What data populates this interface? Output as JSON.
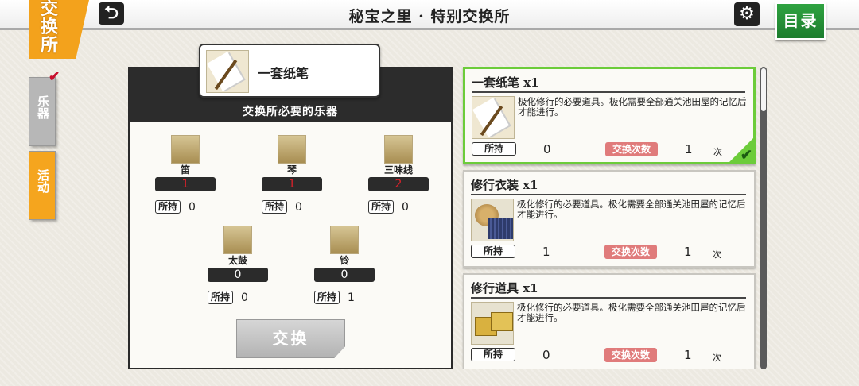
{
  "header": {
    "shop_badge": "交换所",
    "title": "秘宝之里 · 特别交换所",
    "back_icon": "back-arrow-icon",
    "settings_icon": "gear-icon",
    "menu_label": "目录"
  },
  "side_tabs": [
    {
      "label": "乐器",
      "selected": true
    },
    {
      "label": "活动",
      "selected": false
    }
  ],
  "exchange_panel": {
    "selected_item": {
      "name": "一套纸笔"
    },
    "required_heading": "交换所必要的乐器",
    "own_label": "所持",
    "instruments": [
      {
        "name": "笛",
        "required": "1",
        "owned": "0",
        "required_color": "#d8222a"
      },
      {
        "name": "琴",
        "required": "1",
        "owned": "0",
        "required_color": "#d8222a"
      },
      {
        "name": "三味线",
        "required": "2",
        "owned": "0",
        "required_color": "#d8222a"
      },
      {
        "name": "太鼓",
        "required": "0",
        "owned": "0",
        "required_color": "#ffffff"
      },
      {
        "name": "铃",
        "required": "0",
        "owned": "1",
        "required_color": "#ffffff"
      }
    ],
    "exchange_button": "交换"
  },
  "item_list": {
    "own_label": "所持",
    "limit_label": "交换次数",
    "times_unit": "次",
    "items": [
      {
        "name": "一套纸笔 x1",
        "description": "极化修行的必要道具。极化需要全部通关池田屋的记忆后才能进行。",
        "owned": "0",
        "limit": "1",
        "selected": true
      },
      {
        "name": "修行衣装 x1",
        "description": "极化修行的必要道具。极化需要全部通关池田屋的记忆后才能进行。",
        "owned": "1",
        "limit": "1",
        "selected": false
      },
      {
        "name": "修行道具 x1",
        "description": "极化修行的必要道具。极化需要全部通关池田屋的记忆后才能进行。",
        "owned": "0",
        "limit": "1",
        "selected": false
      }
    ]
  },
  "colors": {
    "accent_orange": "#f3a21c",
    "menu_green": "#2fa341",
    "selected_border": "#6ccc3a",
    "limit_tag": "#e07b7b"
  }
}
